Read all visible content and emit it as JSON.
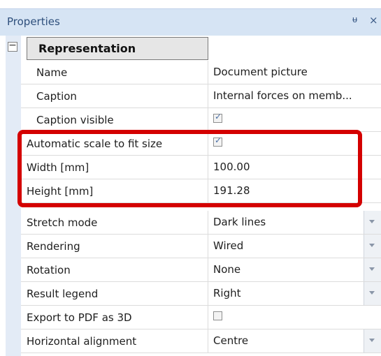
{
  "panel": {
    "title": "Properties",
    "pin_glyph": "ᵾ",
    "close_glyph": "×"
  },
  "category": {
    "expander_sign": "−",
    "label": "Representation"
  },
  "rows": [
    {
      "name": "Name",
      "value": "Document picture"
    },
    {
      "name": "Caption",
      "value": "Internal forces on memb..."
    },
    {
      "name": "Caption visible",
      "checked": true
    },
    {
      "name": "Automatic scale to fit size",
      "checked": true
    },
    {
      "name": "Width [mm]",
      "value": "100.00"
    },
    {
      "name": "Height [mm]",
      "value": "191.28"
    },
    {
      "name": "Stretch mode",
      "value": "Dark lines"
    },
    {
      "name": "Rendering",
      "value": "Wired"
    },
    {
      "name": "Rotation",
      "value": "None"
    },
    {
      "name": "Result legend",
      "value": "Right"
    },
    {
      "name": "Export to PDF as 3D",
      "checked": false
    },
    {
      "name": "Horizontal alignment",
      "value": "Centre"
    }
  ],
  "checkmark_glyph": "✓",
  "colors": {
    "title_bar": "#d6e4f4",
    "gutter": "#e3ebf6",
    "highlight_box": "#d40000",
    "checkmark": "#4a6fa5"
  }
}
